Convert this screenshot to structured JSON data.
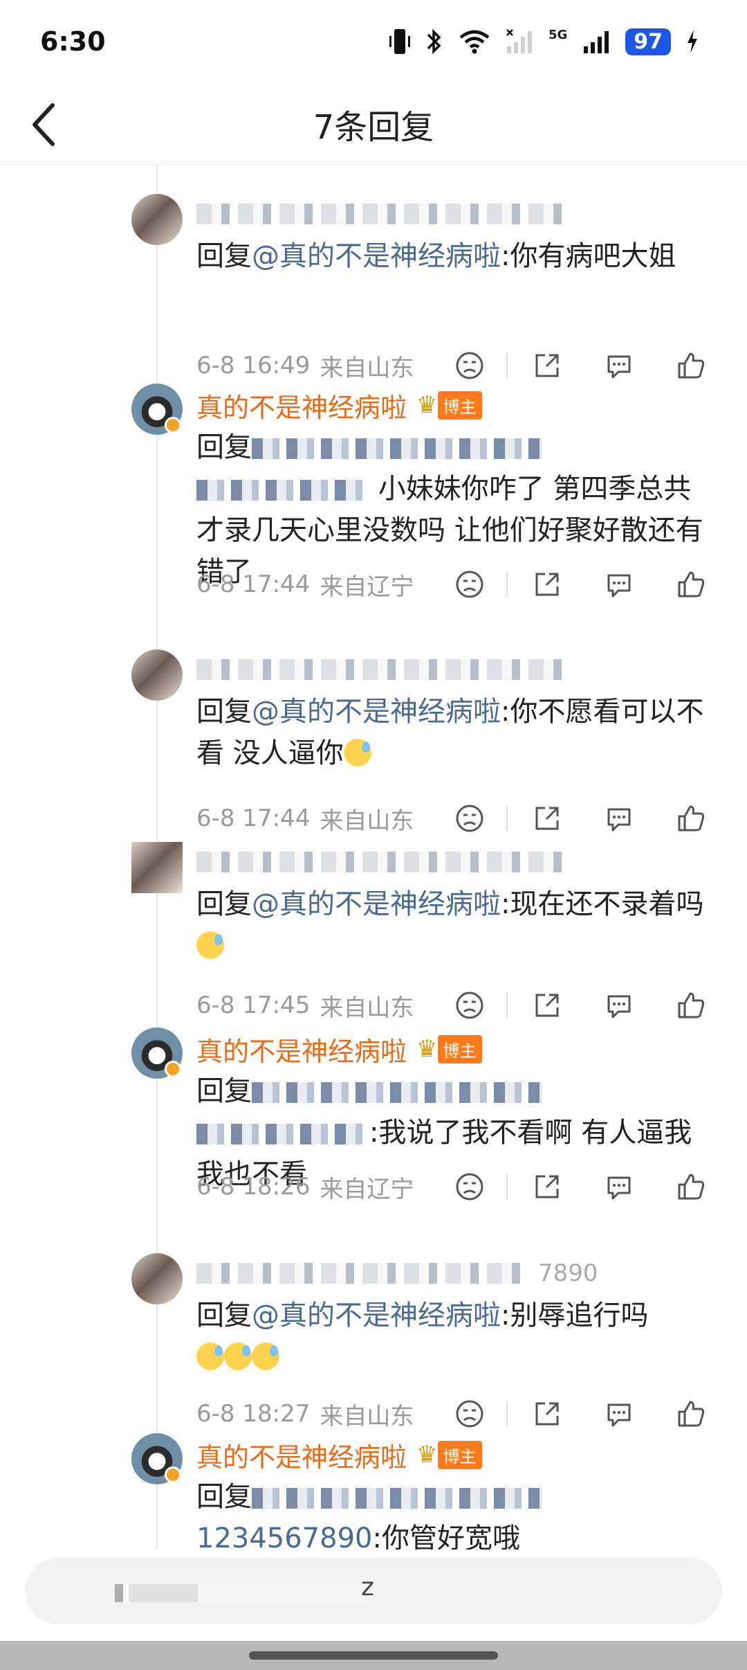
{
  "status_bar": {
    "time": "6:30",
    "network": "5G",
    "battery": "97"
  },
  "header": {
    "title": "7条回复"
  },
  "replies": [
    {
      "type": "user",
      "text_prefix": "回复",
      "mention": "@真的不是神经病啦",
      "text": ":你有病吧大姐",
      "time": "6-8 16:49",
      "location": "来自山东"
    },
    {
      "type": "blogger",
      "name": "真的不是神经病啦",
      "badge": "博主",
      "text_prefix": "回复",
      "text": "小妹妹你咋了 第四季总共才录几天心里没数吗 让他们好聚好散还有错了",
      "time": "6-8 17:44",
      "location": "来自辽宁"
    },
    {
      "type": "user",
      "text_prefix": "回复",
      "mention": "@真的不是神经病啦",
      "text": ":你不愿看可以不看 没人逼你",
      "time": "6-8 17:44",
      "location": "来自山东"
    },
    {
      "type": "user",
      "text_prefix": "回复",
      "mention": "@真的不是神经病啦",
      "text": ":现在还不录着吗",
      "time": "6-8 17:45",
      "location": "来自山东"
    },
    {
      "type": "blogger",
      "name": "真的不是神经病啦",
      "badge": "博主",
      "text_prefix": "回复",
      "text": ":我说了我不看啊 有人逼我我也不看",
      "time": "6-8 18:26",
      "location": "来自辽宁"
    },
    {
      "type": "user",
      "name_suffix": "7890",
      "text_prefix": "回复",
      "mention": "@真的不是神经病啦",
      "text": ":别辱追行吗",
      "time": "6-8 18:27",
      "location": "来自山东"
    },
    {
      "type": "blogger",
      "name": "真的不是神经病啦",
      "badge": "博主",
      "text_prefix": "回复",
      "mention": "1234567890",
      "text": ":你管好宽哦"
    }
  ],
  "input_bar": {
    "suffix": "z"
  },
  "colors": {
    "blogger_name": "#e86b19",
    "mention": "#4a6a92",
    "meta": "#9a9a9a",
    "badge_bg": "#ff7a1a",
    "battery_bg": "#1c57e8"
  },
  "icons": [
    "back-icon",
    "dislike-icon",
    "share-icon",
    "comment-icon",
    "like-icon",
    "crown-icon",
    "verified-badge-icon"
  ]
}
